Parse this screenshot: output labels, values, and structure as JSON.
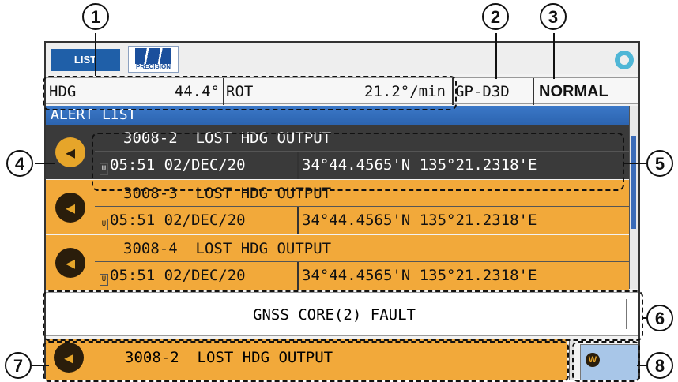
{
  "topbar": {
    "list_label": "LIST",
    "logo_caption": "PRECISION",
    "status_icon": "ring-icon"
  },
  "status": {
    "hdg_label": "HDG",
    "hdg_value": "44.4°",
    "rot_label": "ROT",
    "rot_value": "21.2°/min",
    "fix": "GP-D3D",
    "mode": "NORMAL"
  },
  "alert_list": {
    "title": "ALERT LIST",
    "items": [
      {
        "code": "3008-2",
        "text": "LOST HDG OUTPUT",
        "u": "U",
        "time": "05:51",
        "date": "02/DEC/20",
        "position": "34°44.4565'N 135°21.2318'E"
      },
      {
        "code": "3008-3",
        "text": "LOST HDG OUTPUT",
        "u": "U",
        "time": "05:51",
        "date": "02/DEC/20",
        "position": "34°44.4565'N 135°21.2318'E"
      },
      {
        "code": "3008-4",
        "text": "LOST HDG OUTPUT",
        "u": "U",
        "time": "05:51",
        "date": "02/DEC/20",
        "position": "34°44.4565'N 135°21.2318'E"
      }
    ]
  },
  "message": "GNSS CORE(2) FAULT",
  "bottom": {
    "text": "3008-2  LOST HDG OUTPUT",
    "w_label": "W"
  },
  "callouts": [
    "1",
    "2",
    "3",
    "4",
    "5",
    "6",
    "7",
    "8"
  ],
  "colors": {
    "alert_orange": "#f2a93a",
    "selected_dark": "#3a3a3a",
    "title_blue": "#2c64b0",
    "w_button": "#a8c6e8"
  }
}
